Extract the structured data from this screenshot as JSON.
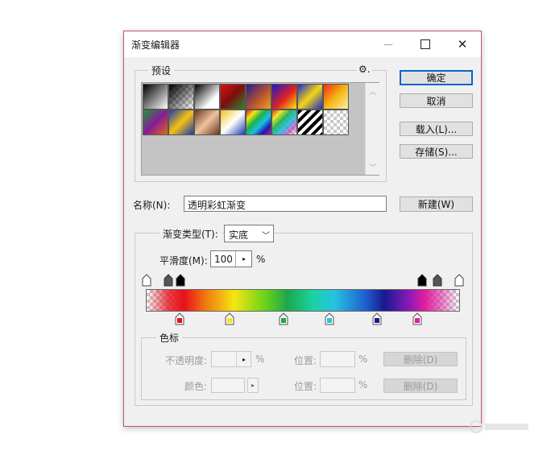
{
  "window": {
    "title": "渐变编辑器",
    "minimize_glyph": "—",
    "maximize_glyph": "☐",
    "close_glyph": "✕"
  },
  "presets": {
    "legend": "预设",
    "gear_glyph": "⚙."
  },
  "buttons": {
    "ok": "确定",
    "cancel": "取消",
    "load": "载入(L)...",
    "save": "存储(S)...",
    "new": "新建(W)"
  },
  "name": {
    "label": "名称(N):",
    "value": "透明彩虹渐变"
  },
  "gradient": {
    "type_label": "渐变类型(T):",
    "type_value": "实底",
    "smooth_label": "平滑度(M):",
    "smooth_value": "100",
    "smooth_unit": "%",
    "color_stops": [
      "#e8111b",
      "#f5e612",
      "#1ca84c",
      "#28c3e0",
      "#17198f",
      "#e01e9e"
    ]
  },
  "color_stops_group": {
    "legend": "色标",
    "opacity_label": "不透明度:",
    "opacity_unit": "%",
    "location_label_1": "位置:",
    "location_unit_1": "%",
    "delete_1": "删除(D)",
    "color_label": "颜色:",
    "location_label_2": "位置:",
    "location_unit_2": "%",
    "delete_2": "删除(D)"
  },
  "colors": {
    "accent": "#0a64c8",
    "window_border": "#c0508a"
  }
}
